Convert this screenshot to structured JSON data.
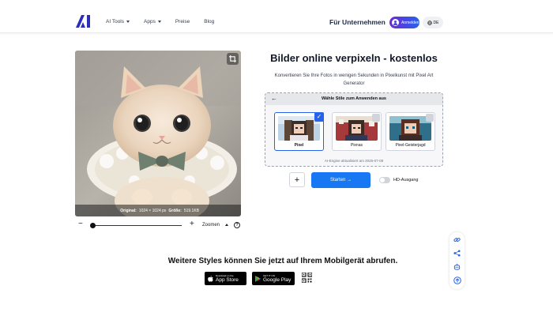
{
  "header": {
    "logo_icon": "ai-logo-icon",
    "nav": [
      {
        "label": "AI Tools",
        "has_dropdown": true
      },
      {
        "label": "Apps",
        "has_dropdown": true
      },
      {
        "label": "Preise",
        "has_dropdown": false
      },
      {
        "label": "Blog",
        "has_dropdown": false
      }
    ],
    "business_label": "Für Unternehmen",
    "login_label": "Anmelden",
    "language_label": "DE"
  },
  "image_panel": {
    "info_original_label": "Original:",
    "info_original_value": "1024 × 1024 px",
    "info_size_label": "Größe:",
    "info_size_value": "519.1KB"
  },
  "zoom": {
    "label": "Zoomen",
    "minus": "−",
    "plus": "+",
    "help": "?",
    "level_fraction": 0.0
  },
  "main": {
    "title": "Bilder online verpixeln - kostenlos",
    "description": "Konvertieren Sie Ihre Fotos in wenigen Sekunden in Pixelkunst mit Pixel Art Generator",
    "style_picker": {
      "header": "Wähle Stile zum Anwenden aus",
      "styles": [
        {
          "label": "Pixel",
          "selected": true
        },
        {
          "label": "Pixnas",
          "selected": false
        },
        {
          "label": "Pixel-Geisterjagd",
          "selected": false
        }
      ],
      "engine_note": "AI-Engine aktualisiert am 2025-07-08"
    },
    "add_label": "+",
    "start_label": "Starten →",
    "hd_label": "HD-Ausgang",
    "hd_enabled": false
  },
  "side_tools": [
    "link-icon",
    "share-icon",
    "bot-icon",
    "scroll-top-icon"
  ],
  "footer": {
    "mobile_text": "Weitere Styles können Sie jetzt auf Ihrem Mobilgerät abrufen.",
    "app_store_small": "Download on the",
    "app_store_big": "App Store",
    "google_play_small": "GET IT ON",
    "google_play_big": "Google Play"
  },
  "colors": {
    "primary": "#1877f2",
    "login_gradient_start": "#6d28d9",
    "login_gradient_end": "#2563eb",
    "logo": "#2b2fb8"
  }
}
